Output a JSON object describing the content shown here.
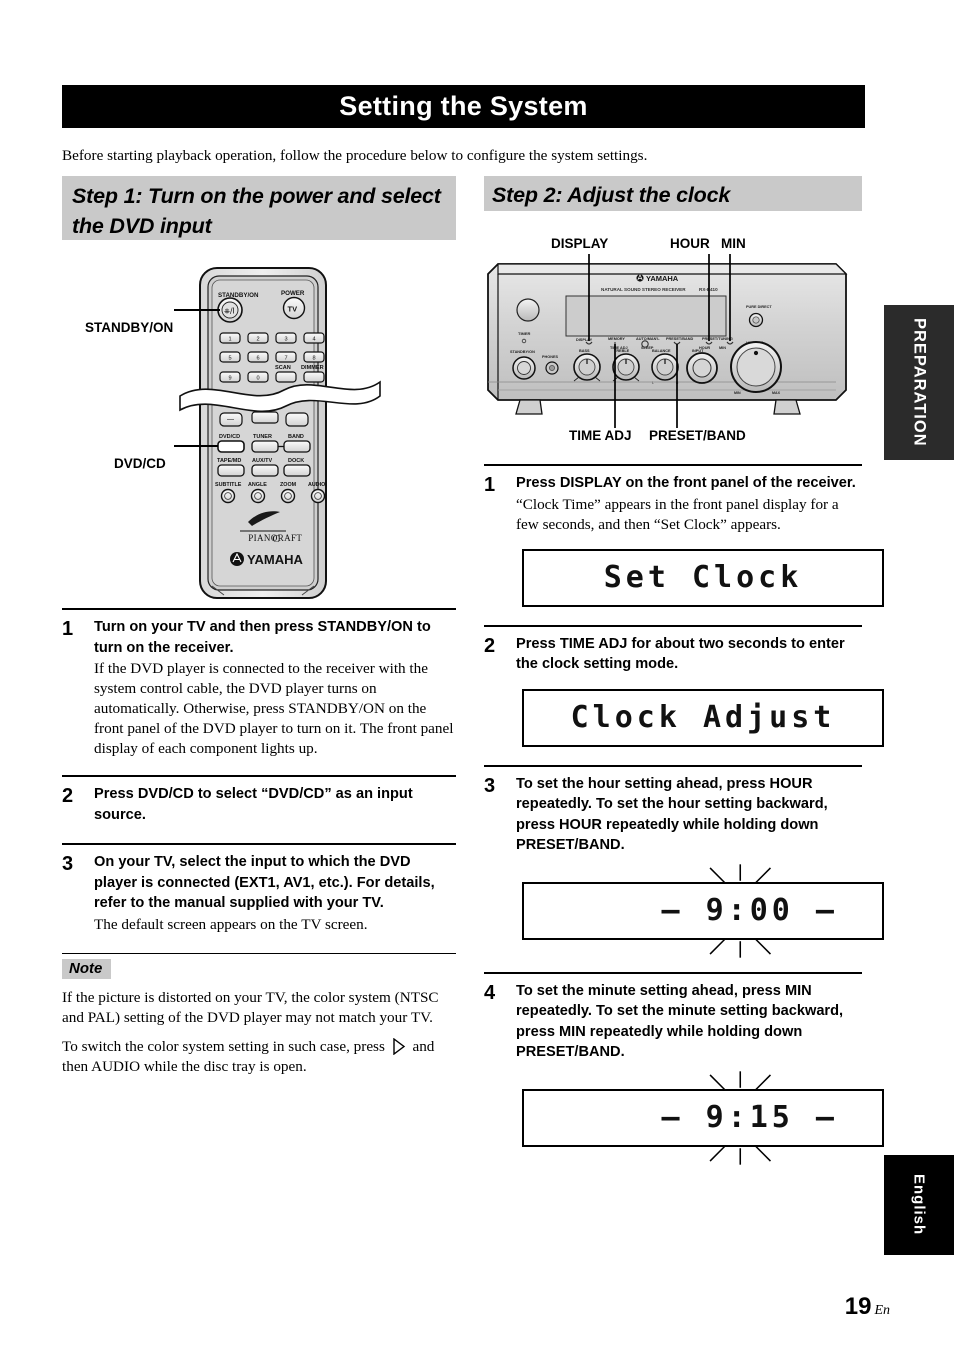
{
  "page": {
    "title": "Setting the System",
    "intro": "Before starting playback operation, follow the procedure below to configure the system settings.",
    "page_number": "19",
    "page_number_suffix": "En"
  },
  "side_tabs": {
    "preparation": "PREPARATION",
    "language": "English"
  },
  "step1": {
    "heading": "Step 1: Turn on the power and select the DVD input",
    "figure": {
      "name": "remote-control",
      "callouts": [
        {
          "label": "STANDBY/ON",
          "target": "standby-on-button"
        },
        {
          "label": "DVD/CD",
          "target": "dvd-cd-button"
        }
      ],
      "remote_labels": {
        "standby_on": "STANDBY/ON",
        "power": "POWER",
        "power_inner": "TV",
        "scan": "SCAN",
        "dimmer": "DIMMER",
        "dvd_cd": "DVD/CD",
        "tuner": "TUNER",
        "band": "BAND",
        "tape_md": "TAPE/MD",
        "aux_tv": "AUX/TV",
        "dock": "DOCK",
        "subtitle": "SUBTITLE",
        "angle": "ANGLE",
        "zoom": "ZOOM",
        "audio": "AUDIO",
        "brand_sub": "PIANOCRAFT",
        "brand": "YAMAHA",
        "numbers": [
          "1",
          "2",
          "3",
          "4",
          "5",
          "6",
          "7",
          "8",
          "9",
          "0"
        ]
      }
    },
    "items": [
      {
        "num": "1",
        "lead": "Turn on your TV and then press STANDBY/ON to turn on the receiver.",
        "sub": "If the DVD player is connected to the receiver with the system control cable, the DVD player turns on automatically. Otherwise, press STANDBY/ON on the front panel of the DVD player to turn on it. The front panel display of each component lights up."
      },
      {
        "num": "2",
        "lead": "Press DVD/CD to select “DVD/CD” as an input source.",
        "sub": ""
      },
      {
        "num": "3",
        "lead": "On your TV, select the input to which the DVD player is connected (EXT1, AV1, etc.). For details, refer to the manual supplied with your TV.",
        "sub": "The default screen appears on the TV screen."
      }
    ],
    "note": {
      "tag": "Note",
      "p1": "If the picture is distorted on your TV, the color system (NTSC and PAL) setting of the DVD player may not match your TV.",
      "p2_before": "To switch the color system setting in such case, press",
      "p2_after": "and then AUDIO while the disc tray is open."
    }
  },
  "step2": {
    "heading": "Step 2: Adjust the clock",
    "figure": {
      "name": "receiver-front-panel",
      "callouts_top": [
        "DISPLAY",
        "HOUR",
        "MIN"
      ],
      "callouts_bottom": [
        "TIME ADJ",
        "PRESET/BAND"
      ],
      "panel_labels": {
        "brand": "YAMAHA",
        "model_line": "NATURAL SOUND STEREO RECEIVER",
        "model": "RX-E410",
        "timer": "TIMER",
        "standby_on": "STANDBY/ON",
        "phones": "PHONES",
        "bass": "BASS",
        "treble": "TREBLE",
        "balance": "BALANCE",
        "input": "INPUT",
        "volume": "VOLUME",
        "volume_min": "MIN",
        "volume_max": "MAX",
        "pure_direct": "PURE DIRECT",
        "display": "DISPLAY",
        "memory": "MEMORY",
        "time_adj": "TIME ADJ",
        "auto_man": "AUTO/MAN'L",
        "sleep": "SLEEP",
        "preset_band": "PRESET/BAND",
        "preset_tuning": "PRESET/TUNING",
        "hour": "HOUR",
        "min": "MIN"
      }
    },
    "items": [
      {
        "num": "1",
        "lead": "Press DISPLAY on the front panel of the receiver.",
        "sub": "“Clock Time” appears in the front panel display for a few seconds, and then “Set Clock” appears.",
        "lcd": "Set Clock",
        "lcd_align": "center",
        "blinking": false
      },
      {
        "num": "2",
        "lead": "Press TIME ADJ for about two seconds to enter the clock setting mode.",
        "sub": "",
        "lcd": "Clock Adjust",
        "lcd_align": "center",
        "blinking": false
      },
      {
        "num": "3",
        "lead": "To set the hour setting ahead, press HOUR repeatedly. To set the hour setting backward, press HOUR repeatedly while holding down PRESET/BAND.",
        "sub": "",
        "lcd": "– 9:00 –",
        "lcd_align": "right",
        "blinking": true
      },
      {
        "num": "4",
        "lead": "To set the minute setting ahead, press MIN repeatedly. To set the minute setting backward, press MIN repeatedly while holding down PRESET/BAND.",
        "sub": "",
        "lcd": "– 9:15 –",
        "lcd_align": "right",
        "blinking": true
      }
    ]
  }
}
